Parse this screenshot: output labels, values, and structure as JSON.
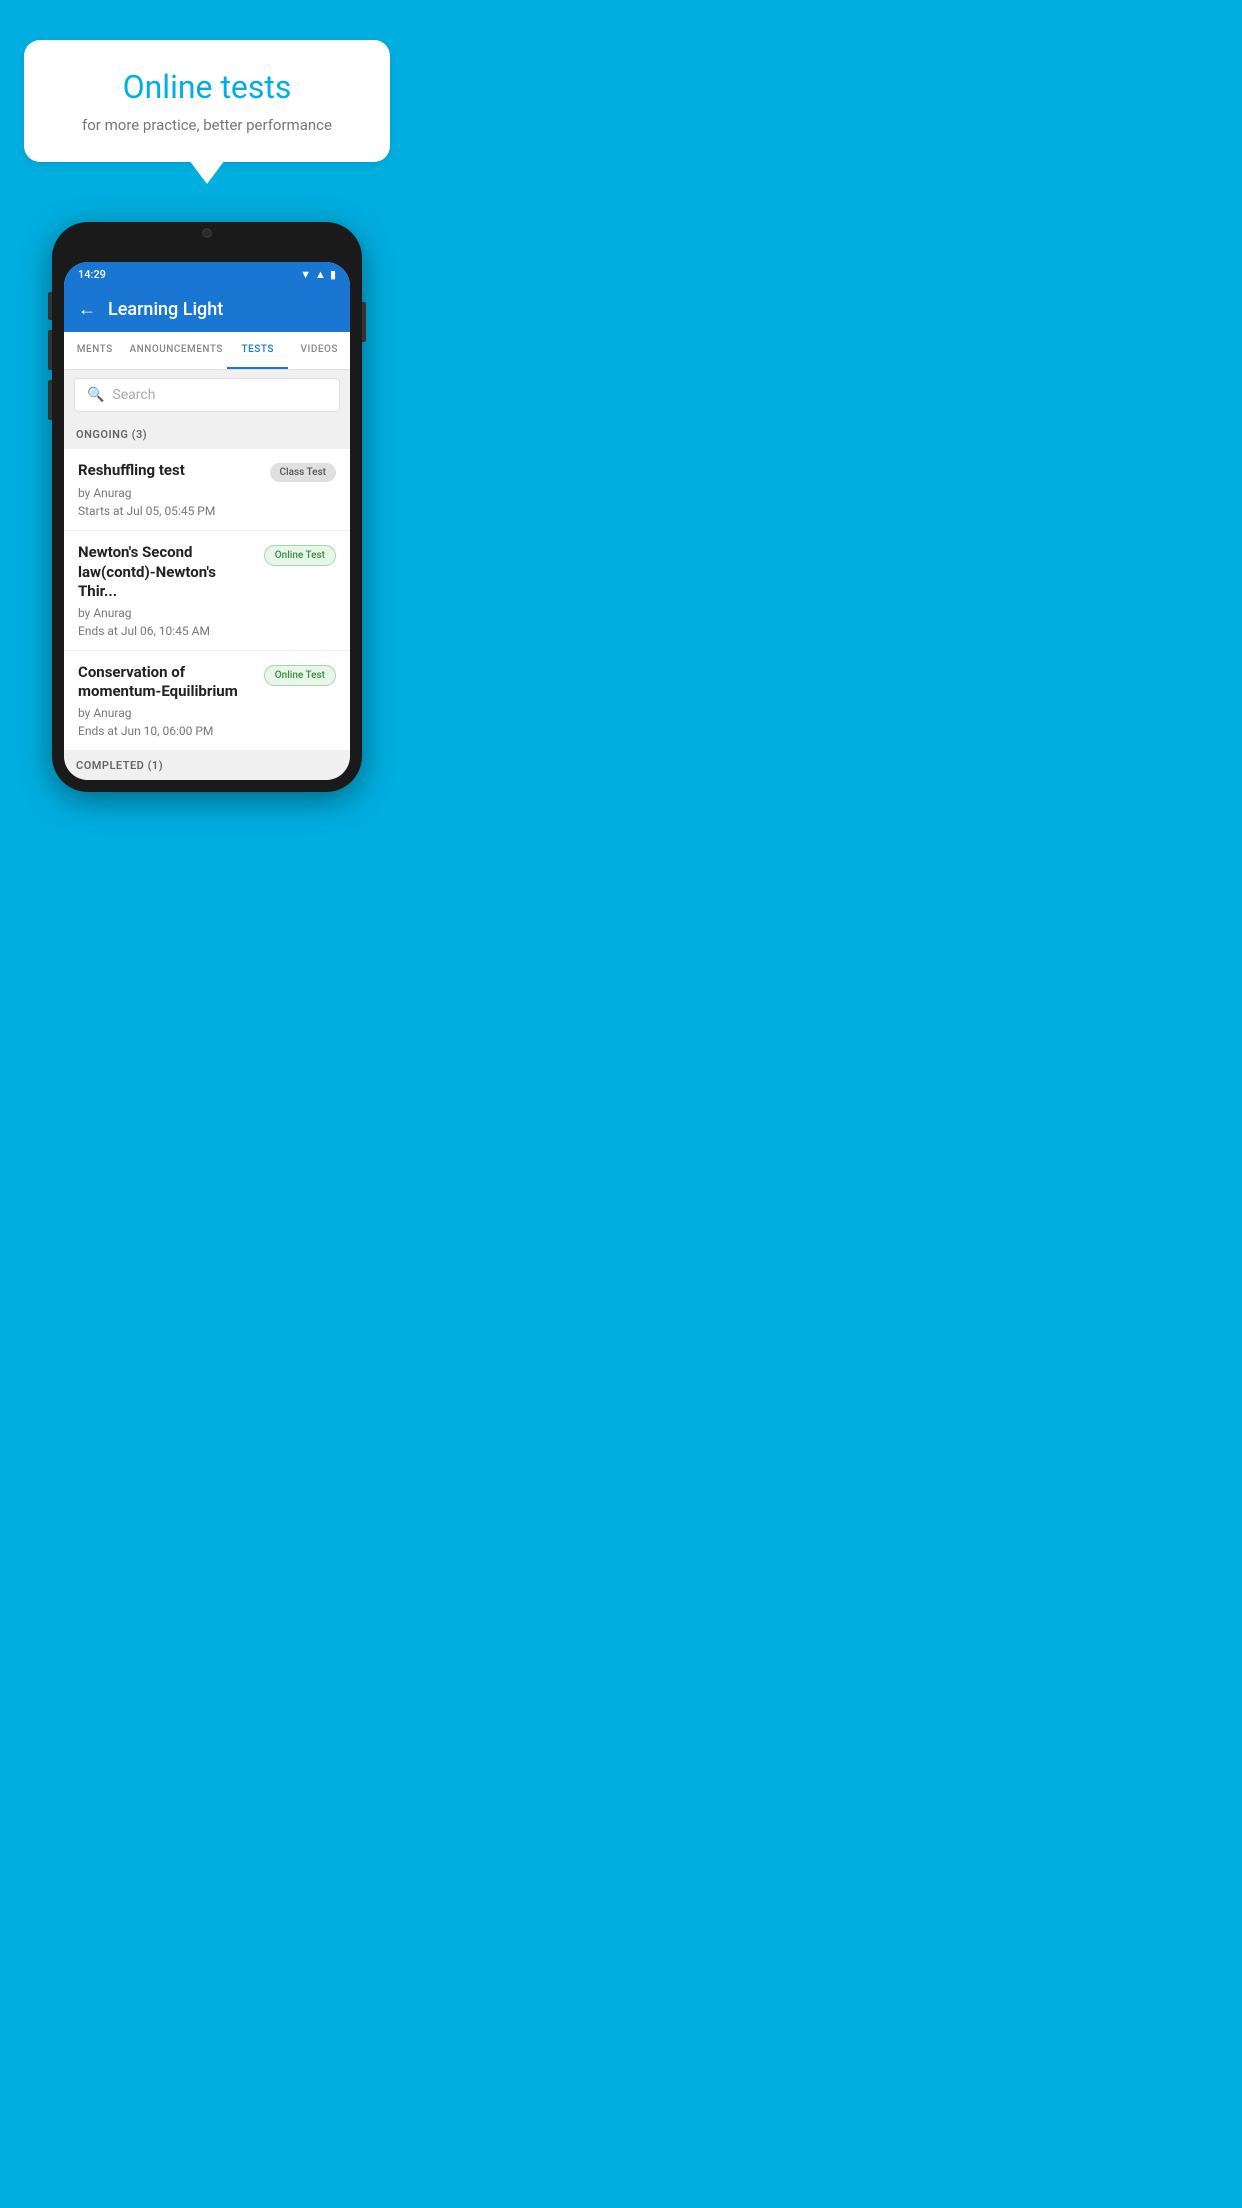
{
  "background_color": "#00AEDF",
  "bubble": {
    "title": "Online tests",
    "subtitle": "for more practice, better performance"
  },
  "status_bar": {
    "time": "14:29"
  },
  "app_bar": {
    "title": "Learning Light",
    "back_label": "←"
  },
  "tabs": [
    {
      "label": "MENTS",
      "active": false
    },
    {
      "label": "ANNOUNCEMENTS",
      "active": false
    },
    {
      "label": "TESTS",
      "active": true
    },
    {
      "label": "VIDEOS",
      "active": false
    }
  ],
  "search": {
    "placeholder": "Search"
  },
  "sections": [
    {
      "label": "ONGOING (3)",
      "items": [
        {
          "title": "Reshuffling test",
          "badge": "Class Test",
          "badge_type": "class",
          "author": "by Anurag",
          "time_label": "Starts at",
          "time": "Jul 05, 05:45 PM"
        },
        {
          "title": "Newton's Second law(contd)-Newton's Thir...",
          "badge": "Online Test",
          "badge_type": "online",
          "author": "by Anurag",
          "time_label": "Ends at",
          "time": "Jul 06, 10:45 AM"
        },
        {
          "title": "Conservation of momentum-Equilibrium",
          "badge": "Online Test",
          "badge_type": "online",
          "author": "by Anurag",
          "time_label": "Ends at",
          "time": "Jun 10, 06:00 PM"
        }
      ]
    }
  ],
  "completed_section": {
    "label": "COMPLETED (1)"
  }
}
